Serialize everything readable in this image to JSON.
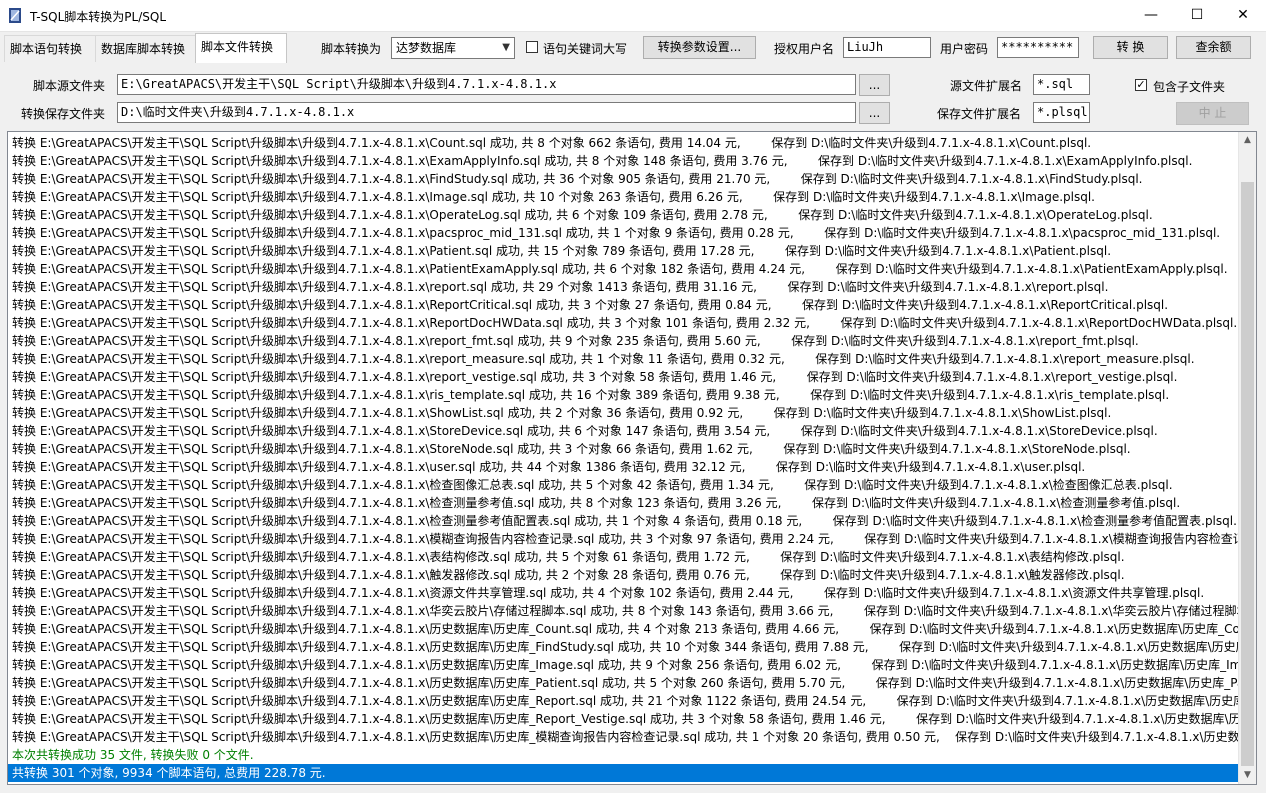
{
  "window": {
    "title": "T-SQL脚本转换为PL/SQL",
    "minimize": "—",
    "maximize": "☐",
    "close": "✕"
  },
  "tabs": [
    {
      "label": "脚本语句转换"
    },
    {
      "label": "数据库脚本转换"
    },
    {
      "label": "脚本文件转换",
      "active": true
    }
  ],
  "toolbar": {
    "convert_to_label": "脚本转换为",
    "target_db": "达梦数据库",
    "uppercase_label": "语句关键词大写",
    "uppercase_checked": false,
    "params_button": "转换参数设置...",
    "license_user_label": "授权用户名",
    "license_user": "LiuJh",
    "password_label": "用户密码",
    "password": "**********",
    "convert_button": "转 换",
    "balance_button": "查余额"
  },
  "source": {
    "folder_label": "脚本源文件夹",
    "folder_value": "E:\\GreatAPACS\\开发主干\\SQL Script\\升级脚本\\升级到4.7.1.x-4.8.1.x",
    "browse": "...",
    "ext_label": "源文件扩展名",
    "ext_value": "*.sql",
    "subfolders_label": "包含子文件夹",
    "subfolders_checked": true
  },
  "target": {
    "folder_label": "转换保存文件夹",
    "folder_value": "D:\\临时文件夹\\升级到4.7.1.x-4.8.1.x",
    "browse": "...",
    "ext_label": "保存文件扩展名",
    "ext_value": "*.plsql",
    "stop_button": "中 止"
  },
  "log": {
    "lines": [
      "转换 E:\\GreatAPACS\\开发主干\\SQL Script\\升级脚本\\升级到4.7.1.x-4.8.1.x\\Count.sql 成功, 共 8 个对象 662 条语句, 费用 14.04 元,        保存到 D:\\临时文件夹\\升级到4.7.1.x-4.8.1.x\\Count.plsql.",
      "转换 E:\\GreatAPACS\\开发主干\\SQL Script\\升级脚本\\升级到4.7.1.x-4.8.1.x\\ExamApplyInfo.sql 成功, 共 8 个对象 148 条语句, 费用 3.76 元,        保存到 D:\\临时文件夹\\升级到4.7.1.x-4.8.1.x\\ExamApplyInfo.plsql.",
      "转换 E:\\GreatAPACS\\开发主干\\SQL Script\\升级脚本\\升级到4.7.1.x-4.8.1.x\\FindStudy.sql 成功, 共 36 个对象 905 条语句, 费用 21.70 元,        保存到 D:\\临时文件夹\\升级到4.7.1.x-4.8.1.x\\FindStudy.plsql.",
      "转换 E:\\GreatAPACS\\开发主干\\SQL Script\\升级脚本\\升级到4.7.1.x-4.8.1.x\\Image.sql 成功, 共 10 个对象 263 条语句, 费用 6.26 元,        保存到 D:\\临时文件夹\\升级到4.7.1.x-4.8.1.x\\Image.plsql.",
      "转换 E:\\GreatAPACS\\开发主干\\SQL Script\\升级脚本\\升级到4.7.1.x-4.8.1.x\\OperateLog.sql 成功, 共 6 个对象 109 条语句, 费用 2.78 元,        保存到 D:\\临时文件夹\\升级到4.7.1.x-4.8.1.x\\OperateLog.plsql.",
      "转换 E:\\GreatAPACS\\开发主干\\SQL Script\\升级脚本\\升级到4.7.1.x-4.8.1.x\\pacsproc_mid_131.sql 成功, 共 1 个对象 9 条语句, 费用 0.28 元,        保存到 D:\\临时文件夹\\升级到4.7.1.x-4.8.1.x\\pacsproc_mid_131.plsql.",
      "转换 E:\\GreatAPACS\\开发主干\\SQL Script\\升级脚本\\升级到4.7.1.x-4.8.1.x\\Patient.sql 成功, 共 15 个对象 789 条语句, 费用 17.28 元,        保存到 D:\\临时文件夹\\升级到4.7.1.x-4.8.1.x\\Patient.plsql.",
      "转换 E:\\GreatAPACS\\开发主干\\SQL Script\\升级脚本\\升级到4.7.1.x-4.8.1.x\\PatientExamApply.sql 成功, 共 6 个对象 182 条语句, 费用 4.24 元,        保存到 D:\\临时文件夹\\升级到4.7.1.x-4.8.1.x\\PatientExamApply.plsql.",
      "转换 E:\\GreatAPACS\\开发主干\\SQL Script\\升级脚本\\升级到4.7.1.x-4.8.1.x\\report.sql 成功, 共 29 个对象 1413 条语句, 费用 31.16 元,        保存到 D:\\临时文件夹\\升级到4.7.1.x-4.8.1.x\\report.plsql.",
      "转换 E:\\GreatAPACS\\开发主干\\SQL Script\\升级脚本\\升级到4.7.1.x-4.8.1.x\\ReportCritical.sql 成功, 共 3 个对象 27 条语句, 费用 0.84 元,        保存到 D:\\临时文件夹\\升级到4.7.1.x-4.8.1.x\\ReportCritical.plsql.",
      "转换 E:\\GreatAPACS\\开发主干\\SQL Script\\升级脚本\\升级到4.7.1.x-4.8.1.x\\ReportDocHWData.sql 成功, 共 3 个对象 101 条语句, 费用 2.32 元,        保存到 D:\\临时文件夹\\升级到4.7.1.x-4.8.1.x\\ReportDocHWData.plsql.",
      "转换 E:\\GreatAPACS\\开发主干\\SQL Script\\升级脚本\\升级到4.7.1.x-4.8.1.x\\report_fmt.sql 成功, 共 9 个对象 235 条语句, 费用 5.60 元,        保存到 D:\\临时文件夹\\升级到4.7.1.x-4.8.1.x\\report_fmt.plsql.",
      "转换 E:\\GreatAPACS\\开发主干\\SQL Script\\升级脚本\\升级到4.7.1.x-4.8.1.x\\report_measure.sql 成功, 共 1 个对象 11 条语句, 费用 0.32 元,        保存到 D:\\临时文件夹\\升级到4.7.1.x-4.8.1.x\\report_measure.plsql.",
      "转换 E:\\GreatAPACS\\开发主干\\SQL Script\\升级脚本\\升级到4.7.1.x-4.8.1.x\\report_vestige.sql 成功, 共 3 个对象 58 条语句, 费用 1.46 元,        保存到 D:\\临时文件夹\\升级到4.7.1.x-4.8.1.x\\report_vestige.plsql.",
      "转换 E:\\GreatAPACS\\开发主干\\SQL Script\\升级脚本\\升级到4.7.1.x-4.8.1.x\\ris_template.sql 成功, 共 16 个对象 389 条语句, 费用 9.38 元,        保存到 D:\\临时文件夹\\升级到4.7.1.x-4.8.1.x\\ris_template.plsql.",
      "转换 E:\\GreatAPACS\\开发主干\\SQL Script\\升级脚本\\升级到4.7.1.x-4.8.1.x\\ShowList.sql 成功, 共 2 个对象 36 条语句, 费用 0.92 元,        保存到 D:\\临时文件夹\\升级到4.7.1.x-4.8.1.x\\ShowList.plsql.",
      "转换 E:\\GreatAPACS\\开发主干\\SQL Script\\升级脚本\\升级到4.7.1.x-4.8.1.x\\StoreDevice.sql 成功, 共 6 个对象 147 条语句, 费用 3.54 元,        保存到 D:\\临时文件夹\\升级到4.7.1.x-4.8.1.x\\StoreDevice.plsql.",
      "转换 E:\\GreatAPACS\\开发主干\\SQL Script\\升级脚本\\升级到4.7.1.x-4.8.1.x\\StoreNode.sql 成功, 共 3 个对象 66 条语句, 费用 1.62 元,        保存到 D:\\临时文件夹\\升级到4.7.1.x-4.8.1.x\\StoreNode.plsql.",
      "转换 E:\\GreatAPACS\\开发主干\\SQL Script\\升级脚本\\升级到4.7.1.x-4.8.1.x\\user.sql 成功, 共 44 个对象 1386 条语句, 费用 32.12 元,        保存到 D:\\临时文件夹\\升级到4.7.1.x-4.8.1.x\\user.plsql.",
      "转换 E:\\GreatAPACS\\开发主干\\SQL Script\\升级脚本\\升级到4.7.1.x-4.8.1.x\\检查图像汇总表.sql 成功, 共 5 个对象 42 条语句, 费用 1.34 元,        保存到 D:\\临时文件夹\\升级到4.7.1.x-4.8.1.x\\检查图像汇总表.plsql.",
      "转换 E:\\GreatAPACS\\开发主干\\SQL Script\\升级脚本\\升级到4.7.1.x-4.8.1.x\\检查测量参考值.sql 成功, 共 8 个对象 123 条语句, 费用 3.26 元,        保存到 D:\\临时文件夹\\升级到4.7.1.x-4.8.1.x\\检查测量参考值.plsql.",
      "转换 E:\\GreatAPACS\\开发主干\\SQL Script\\升级脚本\\升级到4.7.1.x-4.8.1.x\\检查测量参考值配置表.sql 成功, 共 1 个对象 4 条语句, 费用 0.18 元,        保存到 D:\\临时文件夹\\升级到4.7.1.x-4.8.1.x\\检查测量参考值配置表.plsql.",
      "转换 E:\\GreatAPACS\\开发主干\\SQL Script\\升级脚本\\升级到4.7.1.x-4.8.1.x\\模糊查询报告内容检查记录.sql 成功, 共 3 个对象 97 条语句, 费用 2.24 元,        保存到 D:\\临时文件夹\\升级到4.7.1.x-4.8.1.x\\模糊查询报告内容检查记录.plsql.",
      "转换 E:\\GreatAPACS\\开发主干\\SQL Script\\升级脚本\\升级到4.7.1.x-4.8.1.x\\表结构修改.sql 成功, 共 5 个对象 61 条语句, 费用 1.72 元,        保存到 D:\\临时文件夹\\升级到4.7.1.x-4.8.1.x\\表结构修改.plsql.",
      "转换 E:\\GreatAPACS\\开发主干\\SQL Script\\升级脚本\\升级到4.7.1.x-4.8.1.x\\触发器修改.sql 成功, 共 2 个对象 28 条语句, 费用 0.76 元,        保存到 D:\\临时文件夹\\升级到4.7.1.x-4.8.1.x\\触发器修改.plsql.",
      "转换 E:\\GreatAPACS\\开发主干\\SQL Script\\升级脚本\\升级到4.7.1.x-4.8.1.x\\资源文件共享管理.sql 成功, 共 4 个对象 102 条语句, 费用 2.44 元,        保存到 D:\\临时文件夹\\升级到4.7.1.x-4.8.1.x\\资源文件共享管理.plsql.",
      "转换 E:\\GreatAPACS\\开发主干\\SQL Script\\升级脚本\\升级到4.7.1.x-4.8.1.x\\华奕云胶片\\存储过程脚本.sql 成功, 共 8 个对象 143 条语句, 费用 3.66 元,        保存到 D:\\临时文件夹\\升级到4.7.1.x-4.8.1.x\\华奕云胶片\\存储过程脚本.plsql.",
      "转换 E:\\GreatAPACS\\开发主干\\SQL Script\\升级脚本\\升级到4.7.1.x-4.8.1.x\\历史数据库\\历史库_Count.sql 成功, 共 4 个对象 213 条语句, 费用 4.66 元,        保存到 D:\\临时文件夹\\升级到4.7.1.x-4.8.1.x\\历史数据库\\历史库_Count.plsql.",
      "转换 E:\\GreatAPACS\\开发主干\\SQL Script\\升级脚本\\升级到4.7.1.x-4.8.1.x\\历史数据库\\历史库_FindStudy.sql 成功, 共 10 个对象 344 条语句, 费用 7.88 元,        保存到 D:\\临时文件夹\\升级到4.7.1.x-4.8.1.x\\历史数据库\\历史库_FindStudy.plsql.",
      "转换 E:\\GreatAPACS\\开发主干\\SQL Script\\升级脚本\\升级到4.7.1.x-4.8.1.x\\历史数据库\\历史库_Image.sql 成功, 共 9 个对象 256 条语句, 费用 6.02 元,        保存到 D:\\临时文件夹\\升级到4.7.1.x-4.8.1.x\\历史数据库\\历史库_Image.plsql.",
      "转换 E:\\GreatAPACS\\开发主干\\SQL Script\\升级脚本\\升级到4.7.1.x-4.8.1.x\\历史数据库\\历史库_Patient.sql 成功, 共 5 个对象 260 条语句, 费用 5.70 元,        保存到 D:\\临时文件夹\\升级到4.7.1.x-4.8.1.x\\历史数据库\\历史库_Patient.plsql.",
      "转换 E:\\GreatAPACS\\开发主干\\SQL Script\\升级脚本\\升级到4.7.1.x-4.8.1.x\\历史数据库\\历史库_Report.sql 成功, 共 21 个对象 1122 条语句, 费用 24.54 元,        保存到 D:\\临时文件夹\\升级到4.7.1.x-4.8.1.x\\历史数据库\\历史库_Report.plsql.",
      "转换 E:\\GreatAPACS\\开发主干\\SQL Script\\升级脚本\\升级到4.7.1.x-4.8.1.x\\历史数据库\\历史库_Report_Vestige.sql 成功, 共 3 个对象 58 条语句, 费用 1.46 元,        保存到 D:\\临时文件夹\\升级到4.7.1.x-4.8.1.x\\历史数据库\\历史库_Report_Vestige.plsql.",
      "转换 E:\\GreatAPACS\\开发主干\\SQL Script\\升级脚本\\升级到4.7.1.x-4.8.1.x\\历史数据库\\历史库_模糊查询报告内容检查记录.sql 成功, 共 1 个对象 20 条语句, 费用 0.50 元,    保存到 D:\\临时文件夹\\升级到4.7.1.x-4.8.1.x\\历史数据库\\历史库_模糊查询报告内容检查记录.plsql."
    ],
    "summary_files": "本次共转换成功 35 文件, 转换失败 0 个文件.",
    "summary_total": "共转换 301 个对象, 9934 个脚本语句, 总费用 228.78 元."
  },
  "colors": {
    "selection": "#0078d7",
    "success_text": "#008000"
  },
  "icons": {
    "app": "app-icon",
    "scroll_up": "chevron-up-icon",
    "scroll_down": "chevron-down-icon",
    "dropdown": "chevron-down-icon"
  }
}
